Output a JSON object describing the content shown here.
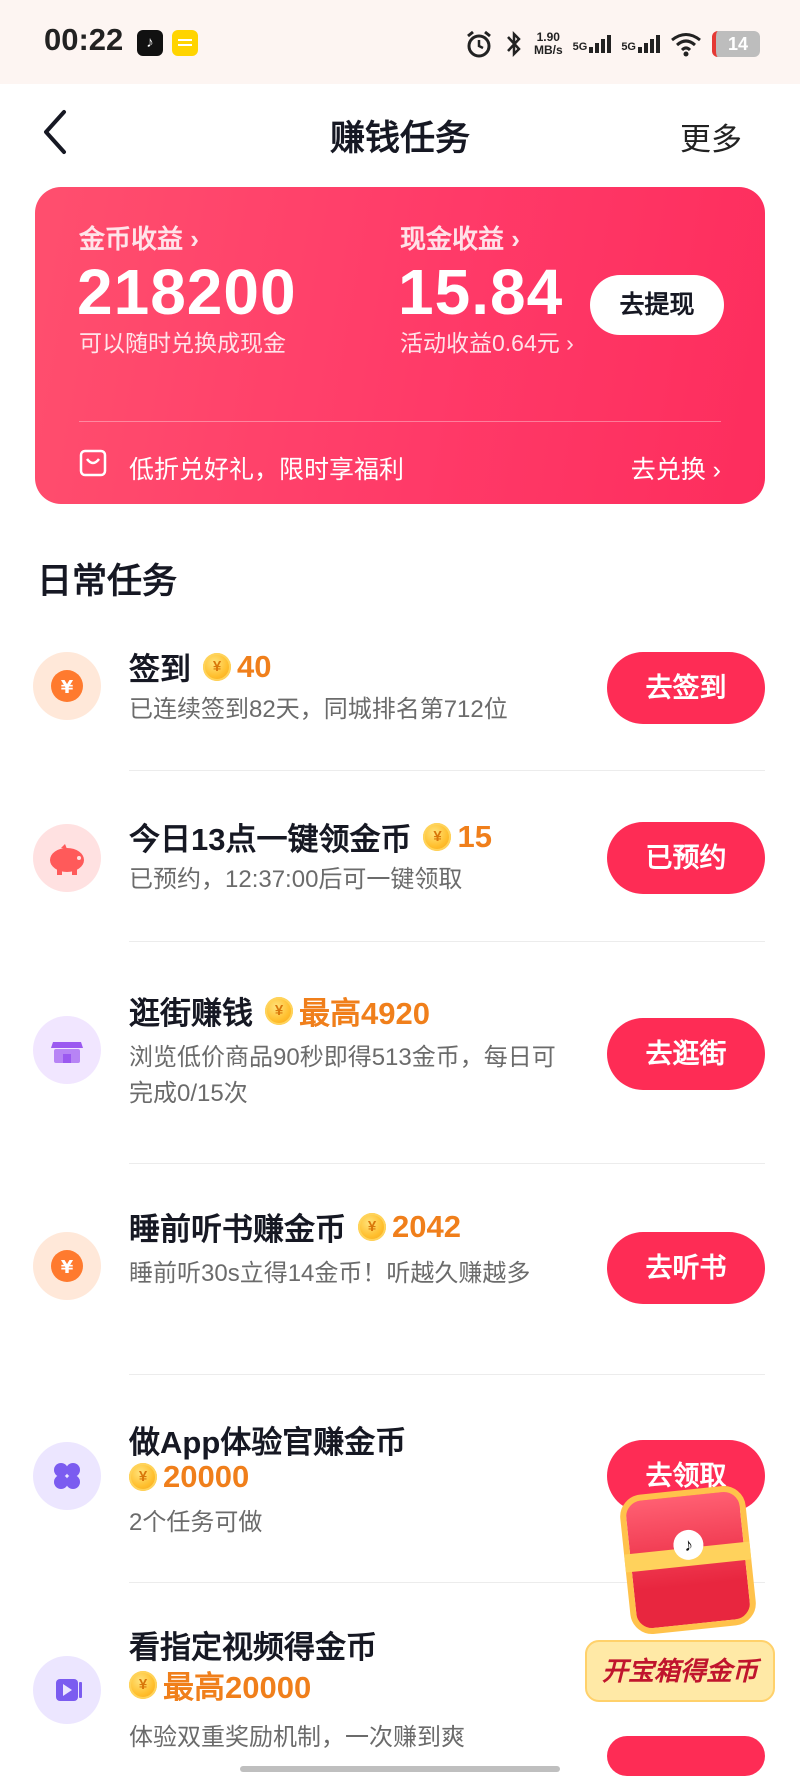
{
  "status_bar": {
    "time": "00:22",
    "app1_glyph": "♪",
    "speed_value": "1.90",
    "speed_unit": "MB/s",
    "sig1": "5G",
    "sig2": "5G",
    "battery": "14"
  },
  "header": {
    "title": "赚钱任务",
    "more": "更多"
  },
  "earnings": {
    "coin_label": "金币收益 ›",
    "coin_value": "218200",
    "coin_sub": "可以随时兑换成现金",
    "cash_label": "现金收益 ›",
    "cash_value": "15.84",
    "cash_sub": "活动收益0.64元 ›",
    "withdraw": "去提现",
    "promo": "低折兑好礼，限时享福利",
    "redeem": "去兑换 ›"
  },
  "section_title": "日常任务",
  "coin_glyph": "¥",
  "tasks": [
    {
      "title": "签到",
      "reward": "40",
      "desc": "已连续签到82天，同城排名第712位",
      "button": "去签到",
      "icon": "yuan-coin-icon"
    },
    {
      "title": "今日13点一键领金币",
      "reward": "15",
      "desc": "已预约，12:37:00后可一键领取",
      "button": "已预约",
      "icon": "piggy-bank-icon"
    },
    {
      "title": "逛街赚钱",
      "reward": "最高4920",
      "desc": "浏览低价商品90秒即得513金币，每日可完成0/15次",
      "button": "去逛街",
      "icon": "shop-icon"
    },
    {
      "title": "睡前听书赚金币",
      "reward": "2042",
      "desc": "睡前听30s立得14金币！听越久赚越多",
      "button": "去听书",
      "icon": "yuan-coin-icon"
    },
    {
      "title": "做App体验官赚金币",
      "reward": "20000",
      "desc": "2个任务可做",
      "button": "去领取",
      "icon": "app-grid-icon"
    },
    {
      "title": "看指定视频得金币",
      "reward": "最高20000",
      "desc": "体验双重奖励机制，一次赚到爽",
      "button": "",
      "icon": "video-icon"
    }
  ],
  "treasure": {
    "label": "开宝箱得金币",
    "logo_glyph": "♪"
  },
  "colors": {
    "accent": "#fe2c55",
    "card_gradient_start": "#ff4f6e",
    "card_gradient_end": "#fd2d5d",
    "reward": "#f07f1b"
  }
}
